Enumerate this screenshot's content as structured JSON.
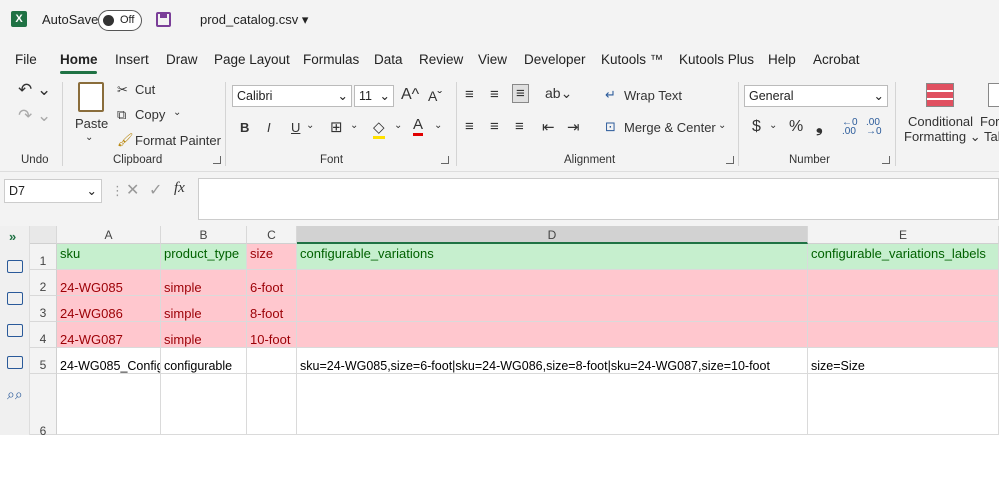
{
  "title_bar": {
    "app_logo": "X",
    "autosave_label": "AutoSave",
    "autosave_state": "Off",
    "filename": "prod_catalog.csv"
  },
  "menu": {
    "tabs": [
      "File",
      "Home",
      "Insert",
      "Draw",
      "Page Layout",
      "Formulas",
      "Data",
      "Review",
      "View",
      "Developer",
      "Kutools ™",
      "Kutools Plus",
      "Help",
      "Acrobat"
    ],
    "active": "Home"
  },
  "ribbon": {
    "undo_group": "Undo",
    "clipboard": {
      "paste": "Paste",
      "cut": "Cut",
      "copy": "Copy",
      "format_painter": "Format Painter",
      "label": "Clipboard"
    },
    "font": {
      "name": "Calibri",
      "size": "11",
      "label": "Font",
      "bold": "B",
      "italic": "I",
      "underline": "U",
      "grow": "A",
      "shrink": "A"
    },
    "alignment": {
      "wrap_text": "Wrap Text",
      "merge_center": "Merge & Center",
      "label": "Alignment"
    },
    "number": {
      "format": "General",
      "currency": "$",
      "percent": "%",
      "comma": "❟",
      "label": "Number"
    },
    "styles": {
      "conditional_formatting_line1": "Conditional",
      "conditional_formatting_line2": "Formatting",
      "format_table_partial_line1": "For",
      "format_table_partial_line2": "Tal"
    }
  },
  "formula_bar": {
    "name_box": "D7",
    "fx": "fx",
    "value": ""
  },
  "sheet": {
    "columns": [
      "A",
      "B",
      "C",
      "D",
      "E"
    ],
    "row_numbers": [
      "1",
      "2",
      "3",
      "4",
      "5",
      "6"
    ],
    "rows": [
      [
        "sku",
        "product_type",
        "size",
        "configurable_variations",
        "configurable_variations_labels"
      ],
      [
        "24-WG085",
        "simple",
        "6-foot",
        "",
        ""
      ],
      [
        "24-WG086",
        "simple",
        "8-foot",
        "",
        ""
      ],
      [
        "24-WG087",
        "simple",
        "10-foot",
        "",
        ""
      ],
      [
        "24-WG085_Config",
        "configurable",
        "",
        "sku=24-WG085,size=6-foot|sku=24-WG086,size=8-foot|sku=24-WG087,size=10-foot",
        "size=Size"
      ],
      [
        "",
        "",
        "",
        "",
        ""
      ]
    ],
    "selected_column": "D",
    "row_styles": [
      "header-green",
      "error-red",
      "error-red",
      "error-red",
      "normal",
      "normal"
    ],
    "colors": {
      "green_fill": "#c6efce",
      "green_text": "#006100",
      "red_fill": "#ffc7ce",
      "red_text": "#9c0006",
      "accent": "#1f7244"
    }
  }
}
